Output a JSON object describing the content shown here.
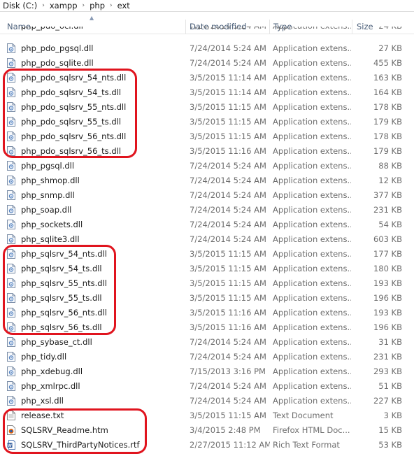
{
  "breadcrumb": {
    "segments": [
      "Disk (C:)",
      "xampp",
      "php",
      "ext"
    ],
    "separator": "›"
  },
  "columns": {
    "name": "Name",
    "date": "Date modified",
    "type": "Type",
    "size": "Size"
  },
  "partial_row": {
    "name": "php_pdo_oci.dll",
    "date": "7/24/2014 5:24 AM",
    "type": "Application extens...",
    "size": "24 KB"
  },
  "files": [
    {
      "name": "php_pdo_pgsql.dll",
      "date": "7/24/2014 5:24 AM",
      "type": "Application extens...",
      "size": "27 KB",
      "icon": "dll-icon"
    },
    {
      "name": "php_pdo_sqlite.dll",
      "date": "7/24/2014 5:24 AM",
      "type": "Application extens...",
      "size": "455 KB",
      "icon": "dll-icon"
    },
    {
      "name": "php_pdo_sqlsrv_54_nts.dll",
      "date": "3/5/2015 11:14 AM",
      "type": "Application extens...",
      "size": "163 KB",
      "icon": "dll-icon"
    },
    {
      "name": "php_pdo_sqlsrv_54_ts.dll",
      "date": "3/5/2015 11:14 AM",
      "type": "Application extens...",
      "size": "164 KB",
      "icon": "dll-icon"
    },
    {
      "name": "php_pdo_sqlsrv_55_nts.dll",
      "date": "3/5/2015 11:15 AM",
      "type": "Application extens...",
      "size": "178 KB",
      "icon": "dll-icon"
    },
    {
      "name": "php_pdo_sqlsrv_55_ts.dll",
      "date": "3/5/2015 11:15 AM",
      "type": "Application extens...",
      "size": "179 KB",
      "icon": "dll-icon"
    },
    {
      "name": "php_pdo_sqlsrv_56_nts.dll",
      "date": "3/5/2015 11:15 AM",
      "type": "Application extens...",
      "size": "178 KB",
      "icon": "dll-icon"
    },
    {
      "name": "php_pdo_sqlsrv_56_ts.dll",
      "date": "3/5/2015 11:16 AM",
      "type": "Application extens...",
      "size": "179 KB",
      "icon": "dll-icon"
    },
    {
      "name": "php_pgsql.dll",
      "date": "7/24/2014 5:24 AM",
      "type": "Application extens...",
      "size": "88 KB",
      "icon": "dll-icon"
    },
    {
      "name": "php_shmop.dll",
      "date": "7/24/2014 5:24 AM",
      "type": "Application extens...",
      "size": "12 KB",
      "icon": "dll-icon"
    },
    {
      "name": "php_snmp.dll",
      "date": "7/24/2014 5:24 AM",
      "type": "Application extens...",
      "size": "377 KB",
      "icon": "dll-icon"
    },
    {
      "name": "php_soap.dll",
      "date": "7/24/2014 5:24 AM",
      "type": "Application extens...",
      "size": "231 KB",
      "icon": "dll-icon"
    },
    {
      "name": "php_sockets.dll",
      "date": "7/24/2014 5:24 AM",
      "type": "Application extens...",
      "size": "54 KB",
      "icon": "dll-icon"
    },
    {
      "name": "php_sqlite3.dll",
      "date": "7/24/2014 5:24 AM",
      "type": "Application extens...",
      "size": "603 KB",
      "icon": "dll-icon"
    },
    {
      "name": "php_sqlsrv_54_nts.dll",
      "date": "3/5/2015 11:15 AM",
      "type": "Application extens...",
      "size": "177 KB",
      "icon": "dll-icon"
    },
    {
      "name": "php_sqlsrv_54_ts.dll",
      "date": "3/5/2015 11:15 AM",
      "type": "Application extens...",
      "size": "180 KB",
      "icon": "dll-icon"
    },
    {
      "name": "php_sqlsrv_55_nts.dll",
      "date": "3/5/2015 11:15 AM",
      "type": "Application extens...",
      "size": "193 KB",
      "icon": "dll-icon"
    },
    {
      "name": "php_sqlsrv_55_ts.dll",
      "date": "3/5/2015 11:15 AM",
      "type": "Application extens...",
      "size": "196 KB",
      "icon": "dll-icon"
    },
    {
      "name": "php_sqlsrv_56_nts.dll",
      "date": "3/5/2015 11:16 AM",
      "type": "Application extens...",
      "size": "193 KB",
      "icon": "dll-icon"
    },
    {
      "name": "php_sqlsrv_56_ts.dll",
      "date": "3/5/2015 11:16 AM",
      "type": "Application extens...",
      "size": "196 KB",
      "icon": "dll-icon"
    },
    {
      "name": "php_sybase_ct.dll",
      "date": "7/24/2014 5:24 AM",
      "type": "Application extens...",
      "size": "31 KB",
      "icon": "dll-icon"
    },
    {
      "name": "php_tidy.dll",
      "date": "7/24/2014 5:24 AM",
      "type": "Application extens...",
      "size": "231 KB",
      "icon": "dll-icon"
    },
    {
      "name": "php_xdebug.dll",
      "date": "7/15/2013 3:16 PM",
      "type": "Application extens...",
      "size": "293 KB",
      "icon": "dll-icon"
    },
    {
      "name": "php_xmlrpc.dll",
      "date": "7/24/2014 5:24 AM",
      "type": "Application extens...",
      "size": "51 KB",
      "icon": "dll-icon"
    },
    {
      "name": "php_xsl.dll",
      "date": "7/24/2014 5:24 AM",
      "type": "Application extens...",
      "size": "227 KB",
      "icon": "dll-icon"
    },
    {
      "name": "release.txt",
      "date": "3/5/2015 11:15 AM",
      "type": "Text Document",
      "size": "3 KB",
      "icon": "text-file-icon"
    },
    {
      "name": "SQLSRV_Readme.htm",
      "date": "3/4/2015 2:48 PM",
      "type": "Firefox HTML Doc...",
      "size": "15 KB",
      "icon": "html-file-icon"
    },
    {
      "name": "SQLSRV_ThirdPartyNotices.rtf",
      "date": "2/27/2015 11:12 AM",
      "type": "Rich Text Format",
      "size": "53 KB",
      "icon": "word-rtf-icon"
    }
  ],
  "colors": {
    "highlight": "#e0141e",
    "header_text": "#4c607a",
    "secondary_text": "#6d6d6d"
  }
}
